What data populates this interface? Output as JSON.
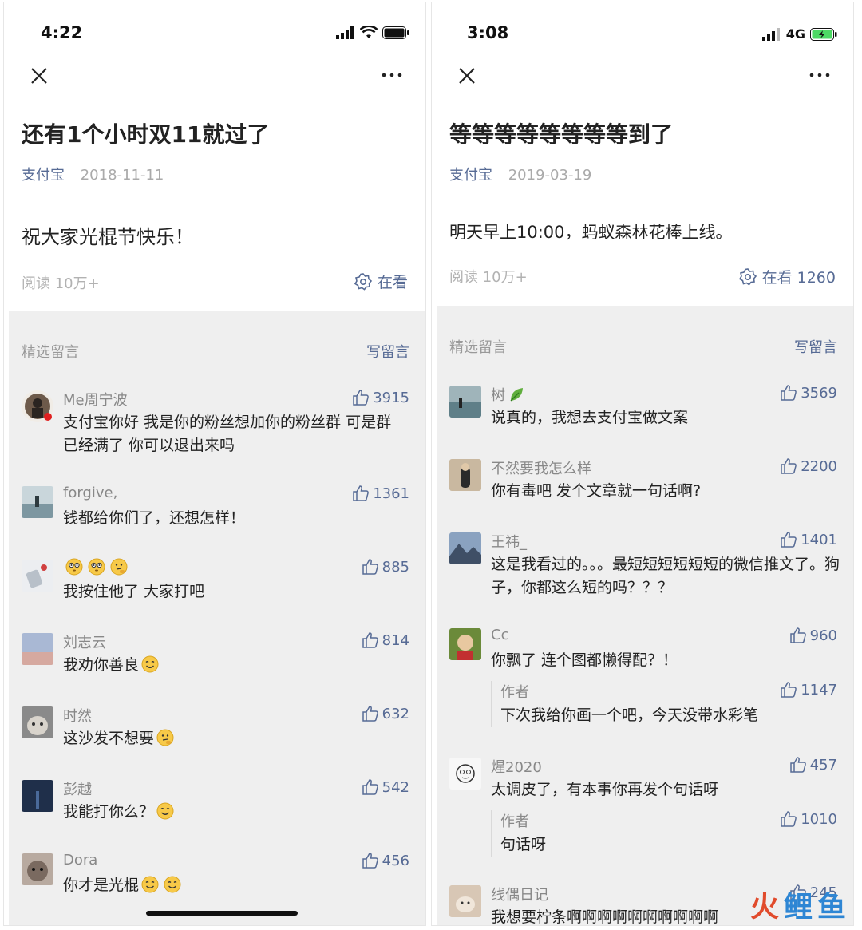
{
  "colors": {
    "link": "#576b95",
    "muted": "#aaaaaa",
    "panel": "#efefef",
    "battery_green": "#4cd964",
    "watermark_red": "#e14b2c",
    "watermark_blue": "#2e86d4"
  },
  "left": {
    "status": {
      "time": "4:22"
    },
    "article": {
      "title": "还有1个小时双11就过了",
      "account": "支付宝",
      "date": "2018-11-11",
      "body": "祝大家光棍节快乐！",
      "reads": "阅读 10万+",
      "zaikan": "在看"
    },
    "comments_header": {
      "selected": "精选留言",
      "write": "写留言"
    },
    "comments": [
      {
        "name": "Me周宁波",
        "likes": "3915",
        "text": "支付宝你好 我是你的粉丝想加你的粉丝群 可是群已经满了 你可以退出来吗",
        "avatar": "#6d5a4a"
      },
      {
        "name": "forgive,",
        "likes": "1361",
        "text": "钱都给你们了，还想怎样！",
        "avatar": "#8fa7b0"
      },
      {
        "name": "",
        "likes": "885",
        "text": "我按住他了 大家打吧",
        "avatar": "#d9dde2",
        "name_emojis": [
          "flushed-emoji",
          "flushed-emoji",
          "thinking-emoji"
        ]
      },
      {
        "name": "刘志云",
        "likes": "814",
        "text": "我劝你善良",
        "avatar": "#a9b8d4",
        "emoji": "smile-emoji"
      },
      {
        "name": "时然",
        "likes": "632",
        "text": "这沙发不想要",
        "avatar": "#9a9a9a",
        "emoji": "thinking-emoji"
      },
      {
        "name": "彭越",
        "likes": "542",
        "text": "我能打你么？",
        "avatar": "#1f2f4a",
        "emoji": "smile-emoji"
      },
      {
        "name": "Dora",
        "likes": "456",
        "text": "你才是光棍",
        "avatar": "#7a6a60",
        "emoji": "double-smile-emoji"
      }
    ]
  },
  "right": {
    "status": {
      "time": "3:08",
      "network": "4G"
    },
    "article": {
      "title": "等等等等等等等等到了",
      "account": "支付宝",
      "date": "2019-03-19",
      "body": "明天早上10:00，蚂蚁森林花棒上线。",
      "reads": "阅读 10万+",
      "zaikan": "在看 1260"
    },
    "comments_header": {
      "selected": "精选留言",
      "write": "写留言"
    },
    "comments": [
      {
        "name": "树",
        "likes": "3569",
        "text": "说真的，我想去支付宝做文案",
        "avatar": "#5f7f88",
        "name_icon": "leaf-icon"
      },
      {
        "name": "不然要我怎么样",
        "likes": "2200",
        "text": "你有毒吧 发个文章就一句话啊?",
        "avatar": "#c9b8a0"
      },
      {
        "name": "王祎_",
        "likes": "1401",
        "text": "这是我看过的。。。最短短短短短短的微信推文了。狗子，你都这么短的吗？？？",
        "avatar": "#3f4f66"
      },
      {
        "name": "Cc",
        "likes": "960",
        "text": "你飘了 连个图都懒得配？！",
        "avatar": "#6b8a3a",
        "reply": {
          "name": "作者",
          "likes": "1147",
          "text": "下次我给你画一个吧，今天没带水彩笔"
        }
      },
      {
        "name": "煋2020",
        "likes": "457",
        "text": "太调皮了，有本事你再发个句话呀",
        "avatar": "#f2f2f2",
        "reply": {
          "name": "作者",
          "likes": "1010",
          "text": "句话呀"
        }
      },
      {
        "name": "线偶日记",
        "likes": "245",
        "text": "我想要柠条啊啊啊啊啊啊啊啊啊啊",
        "avatar": "#d8c7b5"
      }
    ]
  },
  "watermark": {
    "text": [
      "火",
      "鲤",
      "鱼"
    ]
  }
}
